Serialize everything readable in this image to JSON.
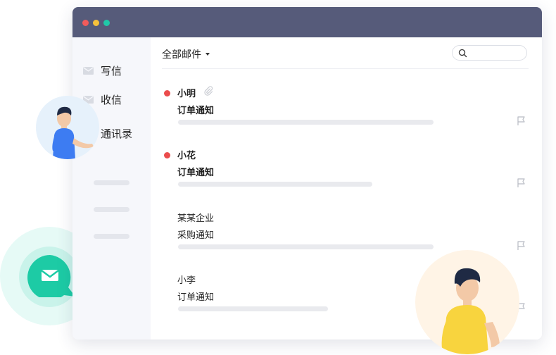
{
  "sidebar": {
    "items": [
      {
        "label": "写信",
        "icon": "mail-icon"
      },
      {
        "label": "收信",
        "icon": "mail-icon"
      },
      {
        "label": "通讯录"
      }
    ]
  },
  "toolbar": {
    "folder_label": "全部邮件",
    "search_placeholder": ""
  },
  "mails": [
    {
      "sender": "小明",
      "subject": "订单通知",
      "unread": true,
      "attachment": true
    },
    {
      "sender": "小花",
      "subject": "订单通知",
      "unread": true,
      "attachment": false
    },
    {
      "sender": "某某企业",
      "subject": "采购通知",
      "unread": false,
      "attachment": false
    },
    {
      "sender": "小李",
      "subject": "订单通知",
      "unread": false,
      "attachment": false
    }
  ],
  "colors": {
    "titlebar": "#565b7a",
    "unread": "#eb4c4c",
    "accent": "#20c9a8"
  }
}
